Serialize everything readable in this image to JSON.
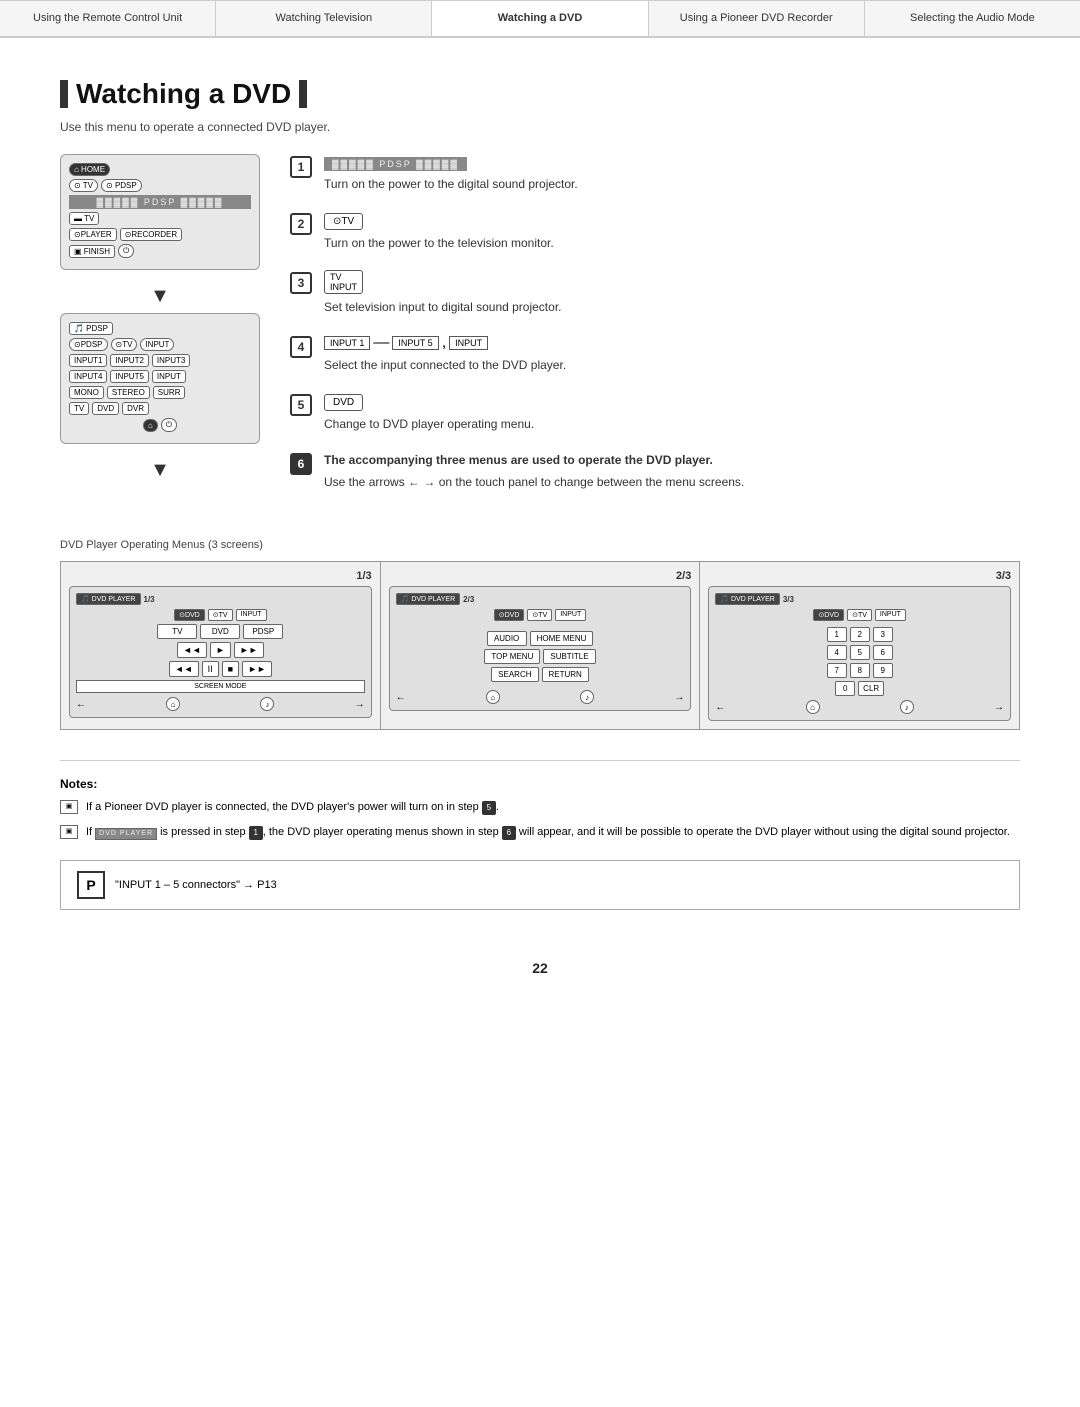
{
  "nav": {
    "items": [
      {
        "label": "Using the Remote Control Unit",
        "active": false
      },
      {
        "label": "Watching Television",
        "active": false
      },
      {
        "label": "Watching a DVD",
        "active": true
      },
      {
        "label": "Using a Pioneer DVD Recorder",
        "active": false
      },
      {
        "label": "Selecting the Audio Mode",
        "active": false
      }
    ]
  },
  "page": {
    "title": "Watching a DVD",
    "subtitle": "Use this menu to operate a connected DVD player."
  },
  "steps": [
    {
      "num": "1",
      "dark": false,
      "icon_type": "pdsp",
      "icon_text": "PDSP",
      "text": "Turn on the power to the digital sound projector."
    },
    {
      "num": "2",
      "dark": false,
      "icon_type": "button",
      "icon_text": "⊙TV",
      "text": "Turn on the power to the television monitor."
    },
    {
      "num": "3",
      "dark": false,
      "icon_type": "button",
      "icon_text": "TV INPUT",
      "text": "Set television input to digital sound projector."
    },
    {
      "num": "4",
      "dark": false,
      "icon_type": "inputs",
      "text": "Select the input connected to the DVD player."
    },
    {
      "num": "5",
      "dark": false,
      "icon_type": "button",
      "icon_text": "DVD",
      "text": "Change to DVD player operating menu."
    },
    {
      "num": "6",
      "dark": true,
      "icon_type": "none",
      "text_bold": "The accompanying three menus are used to operate the DVD player.",
      "text_normal": "Use the arrows ← → on the touch panel to change between the menu screens."
    }
  ],
  "dvd_menus": {
    "label": "DVD Player Operating Menus (3 screens)",
    "screens": [
      {
        "fraction": "1/3",
        "label": "1/3",
        "header_left": "DVD PLAYER",
        "header_num": "1/3",
        "rows": [
          [
            "⊙DVD PLAYER",
            "⊙TV",
            "INPUT"
          ],
          [
            "TV",
            "DVD",
            "PDSP"
          ],
          [
            "◄◄",
            "►",
            "►►"
          ],
          [
            "◄◄",
            "II",
            "■",
            "►►"
          ],
          [
            "SCREEN MODE"
          ]
        ],
        "footer": [
          "←",
          "⌂",
          "♪",
          "→"
        ]
      },
      {
        "fraction": "2/3",
        "label": "2/3",
        "header_left": "DVD PLAYER",
        "header_num": "2/3",
        "rows": [
          [
            "⊙DVD PLAYER",
            "⊙TV",
            "INPUT"
          ],
          [
            "AUDIO",
            "HOME MENU"
          ],
          [
            "TOP MENU",
            "SUBTITLE"
          ],
          [
            "SEARCH",
            "RETURN"
          ]
        ],
        "footer": [
          "←",
          "⌂",
          "♪",
          "→"
        ]
      },
      {
        "fraction": "3/3",
        "label": "3/3",
        "header_left": "DVD PLAYER",
        "header_num": "3/3",
        "rows": [
          [
            "⊙DVD PLAYER",
            "⊙TV",
            "INPUT"
          ],
          [
            "1",
            "2",
            "3"
          ],
          [
            "4",
            "5",
            "6"
          ],
          [
            "7",
            "8",
            "9"
          ],
          [
            "0",
            "CLR"
          ]
        ],
        "footer": [
          "←",
          "⌂",
          "♪",
          "→"
        ]
      }
    ]
  },
  "notes": {
    "title": "Notes:",
    "items": [
      "If a Pioneer DVD player is connected, the DVD player's power will turn on in step 5.",
      "If [DVD PLAYER] is pressed in step 1, the DVD player operating menus shown in step 6 will appear, and it will be possible to operate the DVD player without using the digital sound projector."
    ]
  },
  "reference": {
    "icon": "P",
    "text": "\"INPUT 1 – 5 connectors\" → P13"
  },
  "page_number": "22"
}
